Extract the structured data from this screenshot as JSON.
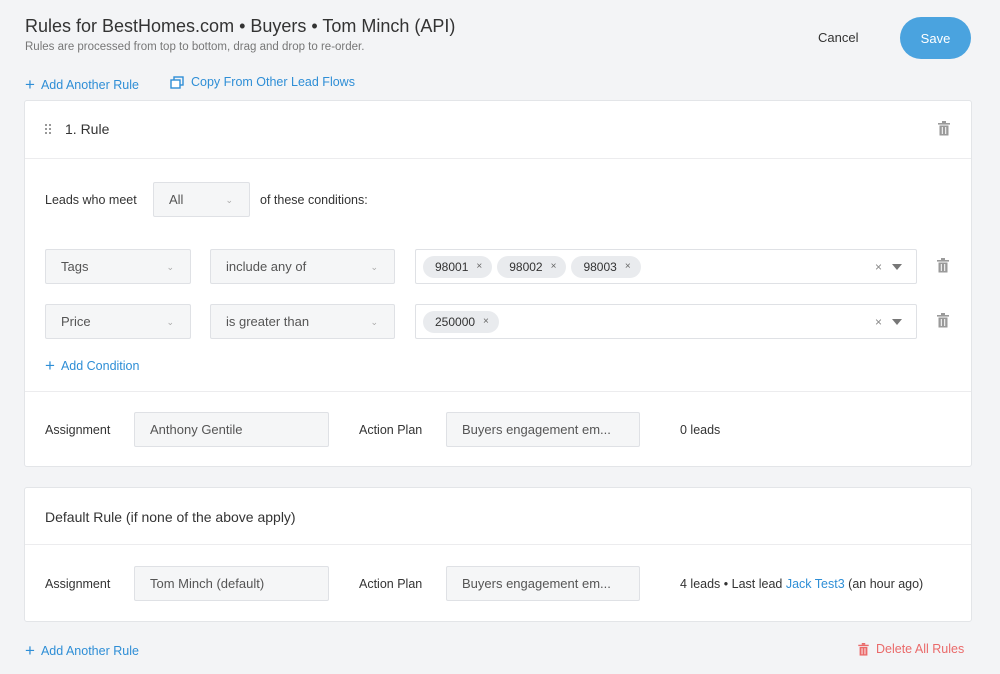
{
  "header": {
    "title": "Rules for BestHomes.com • Buyers • Tom Minch (API)",
    "subtitle": "Rules are processed from top to bottom, drag and drop to re-order.",
    "cancel_label": "Cancel",
    "save_label": "Save"
  },
  "top_actions": {
    "add_rule_label": "Add Another Rule",
    "copy_label": "Copy From Other Lead Flows"
  },
  "rule1": {
    "title": "1. Rule",
    "leads_who_meet": "Leads who meet",
    "match_value": "All",
    "of_these_conditions": "of these conditions:",
    "conditions": [
      {
        "field": "Tags",
        "operator": "include any of",
        "values": [
          "98001",
          "98002",
          "98003"
        ]
      },
      {
        "field": "Price",
        "operator": "is greater than",
        "values": [
          "250000"
        ]
      }
    ],
    "add_condition_label": "Add Condition",
    "assignment_label": "Assignment",
    "assignment_value": "Anthony Gentile",
    "action_plan_label": "Action Plan",
    "action_plan_value": "Buyers engagement em...",
    "lead_count": "0 leads"
  },
  "default_rule": {
    "title": "Default Rule (if none of the above apply)",
    "assignment_label": "Assignment",
    "assignment_value": "Tom Minch (default)",
    "action_plan_label": "Action Plan",
    "action_plan_value": "Buyers engagement em...",
    "stats_prefix": "4 leads • Last lead",
    "last_lead_name": "Jack Test3",
    "last_lead_time": "(an hour ago)"
  },
  "bottom_actions": {
    "add_rule_label": "Add Another Rule",
    "delete_all_label": "Delete All Rules"
  },
  "icons": {
    "add": "plus-icon",
    "copy": "copy-icon",
    "drag": "drag-handle-icon",
    "delete": "trash-icon",
    "dropdown": "chevron-down-icon",
    "clear": "clear-icon"
  },
  "colors": {
    "accent": "#2e8ed6",
    "save_button": "#4aa3df",
    "danger": "#ea6a6a"
  }
}
